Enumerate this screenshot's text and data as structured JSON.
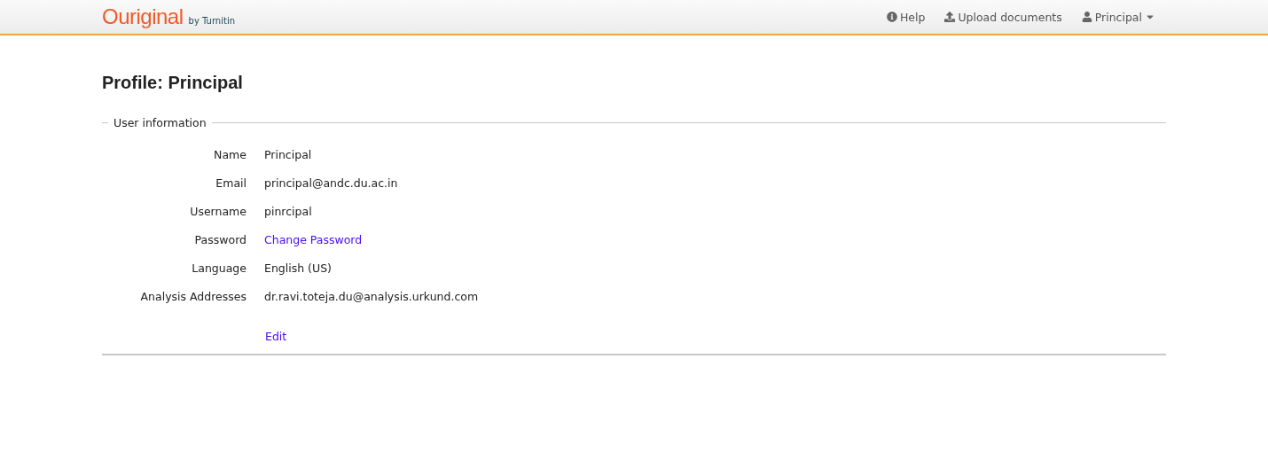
{
  "header": {
    "logo": "Ouriginal",
    "logo_suffix": "by Turnitin",
    "nav": [
      {
        "kind": "help",
        "label": "Help"
      },
      {
        "kind": "upload",
        "label": "Upload documents"
      },
      {
        "kind": "user",
        "label": "Principal"
      }
    ]
  },
  "page_title": "Profile: Principal",
  "section": {
    "legend": "User information",
    "rows": [
      {
        "label": "Name",
        "value": "Principal",
        "kind": "text"
      },
      {
        "label": "Email",
        "value": "principal@andc.du.ac.in",
        "kind": "text"
      },
      {
        "label": "Username",
        "value": "pinrcipal",
        "kind": "text"
      },
      {
        "label": "Password",
        "value": "Change Password",
        "kind": "link"
      },
      {
        "label": "Language",
        "value": "English (US)",
        "kind": "text"
      },
      {
        "label": "Analysis Addresses",
        "value": "dr.ravi.toteja.du@analysis.urkund.com",
        "kind": "text"
      }
    ],
    "edit_link": "Edit"
  }
}
